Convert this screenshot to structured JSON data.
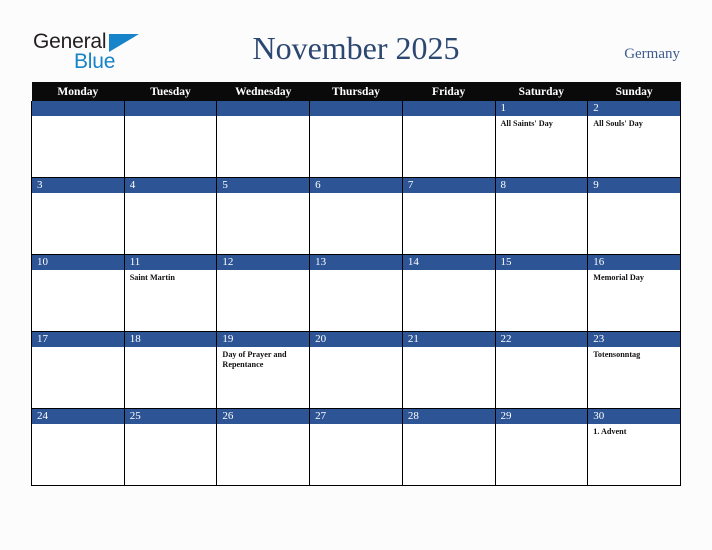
{
  "brand": {
    "line1": "General",
    "line2": "Blue",
    "accent_color": "#1783c8",
    "text_color": "#231f20"
  },
  "header": {
    "title": "November 2025",
    "country": "Germany",
    "title_color": "#2c4770"
  },
  "calendar": {
    "weekday_headers": [
      "Monday",
      "Tuesday",
      "Wednesday",
      "Thursday",
      "Friday",
      "Saturday",
      "Sunday"
    ],
    "header_bg": "#0a0a0a",
    "daynum_bg": "#2d5494",
    "weeks": [
      [
        {
          "day": "",
          "events": []
        },
        {
          "day": "",
          "events": []
        },
        {
          "day": "",
          "events": []
        },
        {
          "day": "",
          "events": []
        },
        {
          "day": "",
          "events": []
        },
        {
          "day": "1",
          "events": [
            "All Saints' Day"
          ]
        },
        {
          "day": "2",
          "events": [
            "All Souls' Day"
          ]
        }
      ],
      [
        {
          "day": "3",
          "events": []
        },
        {
          "day": "4",
          "events": []
        },
        {
          "day": "5",
          "events": []
        },
        {
          "day": "6",
          "events": []
        },
        {
          "day": "7",
          "events": []
        },
        {
          "day": "8",
          "events": []
        },
        {
          "day": "9",
          "events": []
        }
      ],
      [
        {
          "day": "10",
          "events": []
        },
        {
          "day": "11",
          "events": [
            "Saint Martin"
          ]
        },
        {
          "day": "12",
          "events": []
        },
        {
          "day": "13",
          "events": []
        },
        {
          "day": "14",
          "events": []
        },
        {
          "day": "15",
          "events": []
        },
        {
          "day": "16",
          "events": [
            "Memorial Day"
          ]
        }
      ],
      [
        {
          "day": "17",
          "events": []
        },
        {
          "day": "18",
          "events": []
        },
        {
          "day": "19",
          "events": [
            "Day of Prayer and Repentance"
          ]
        },
        {
          "day": "20",
          "events": []
        },
        {
          "day": "21",
          "events": []
        },
        {
          "day": "22",
          "events": []
        },
        {
          "day": "23",
          "events": [
            "Totensonntag"
          ]
        }
      ],
      [
        {
          "day": "24",
          "events": []
        },
        {
          "day": "25",
          "events": []
        },
        {
          "day": "26",
          "events": []
        },
        {
          "day": "27",
          "events": []
        },
        {
          "day": "28",
          "events": []
        },
        {
          "day": "29",
          "events": []
        },
        {
          "day": "30",
          "events": [
            "1. Advent"
          ]
        }
      ]
    ]
  }
}
